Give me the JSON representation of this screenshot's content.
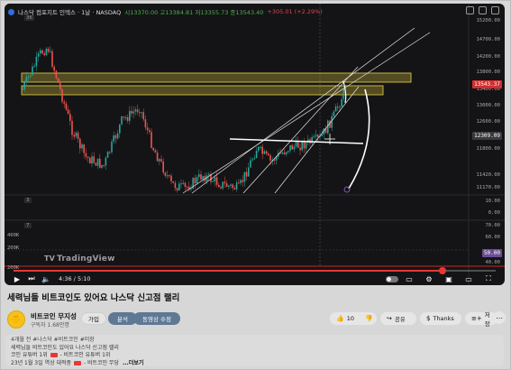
{
  "player": {
    "symbol": "나스닥 컴포지트 인덱스 · 1날 · NASDAQ",
    "ohlc": "시13370.00 고13384.81 저13355.73 종13543.40",
    "change": "+305.01 (+2.29%)",
    "price_axis": [
      "15200.00",
      "14700.00",
      "14200.00",
      "13800.00",
      "13400.00",
      "13000.00",
      "12600.00",
      "12200.00",
      "11800.00",
      "11420.00",
      "11170.00",
      "10.00",
      "0.00"
    ],
    "current_price": "13543.37",
    "crosshair_price": "12309.09",
    "current_price_color": "#d32f2f",
    "crosshair_price_color": "#3a3a3e",
    "pane_markers": [
      "36",
      "3",
      "7"
    ],
    "rsi_axis": [
      "70.00",
      "60.00",
      "50.00",
      "40.00"
    ],
    "volume_axis": [
      "400K",
      "200K",
      "200K"
    ],
    "rsi_tag": "50.00",
    "brand": "TradingView",
    "time_current": "4:36",
    "time_total": "5:10",
    "progress": 0.89,
    "icons": [
      "play-icon",
      "next-icon",
      "volume-icon",
      "autoplay-toggle",
      "captions-icon",
      "settings-icon",
      "miniplayer-icon",
      "theater-icon",
      "fullscreen-icon"
    ]
  },
  "video": {
    "title": "세력님들 비트코인도 있어요 나스닥 신고점 랠리"
  },
  "channel": {
    "name": "비트코인 무지성",
    "subscribers": "구독자 1.68만명",
    "join_label": "가입",
    "analysis_label": "분석",
    "edit_label": "동영상 수정",
    "avatar_emoji": "🐥"
  },
  "actions": {
    "likes": "10",
    "share": "공유",
    "thanks": "Thanks",
    "save": "저장",
    "more": "⋯"
  },
  "description": {
    "meta_line": "4개월 전  #나스닥 #비트코인 #미장",
    "line1": "세력님들 비트코인도 있어요 나스닥 신고점 랠리",
    "line2": "코인 유튜버 1위 ",
    "line2b": " - 비트코인 유튜버 1위",
    "line3": "23년 1월 3일 역상 대적중 ",
    "line3b": " - 비트코인 무당",
    "more": "...더보기"
  }
}
